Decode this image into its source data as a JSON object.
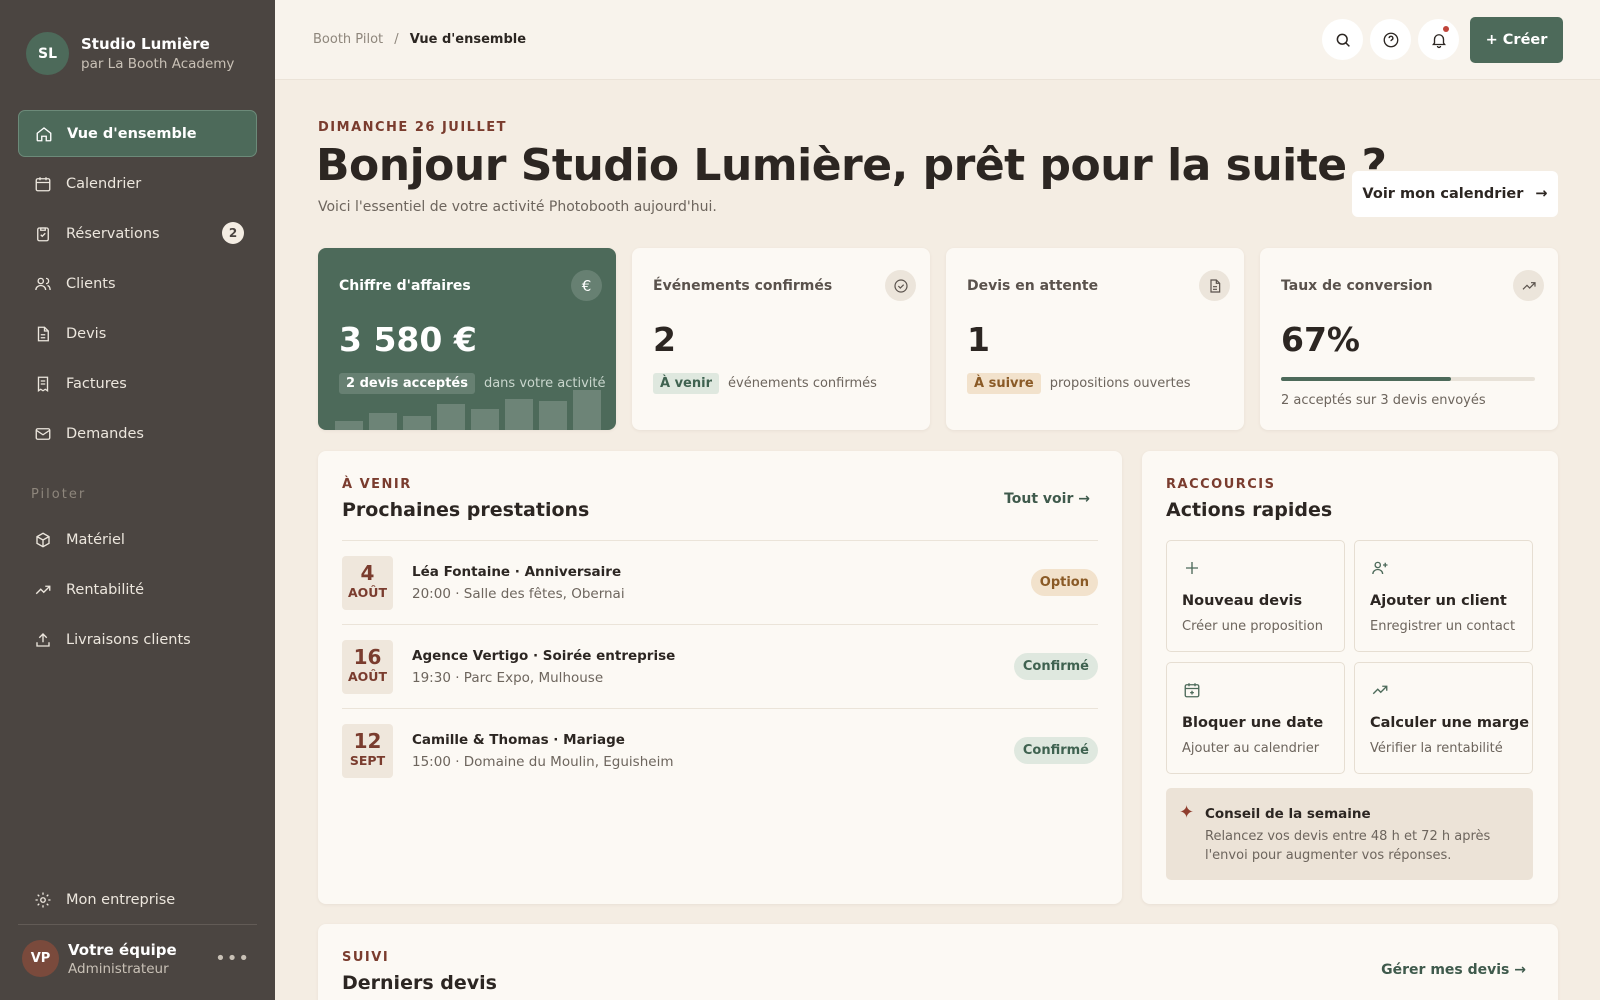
{
  "sidebar": {
    "avatar": "SL",
    "name": "Studio Lumière",
    "subtitle": "par La Booth Academy",
    "nav": [
      {
        "label": "Vue d'ensemble",
        "icon": "home-icon",
        "active": true
      },
      {
        "label": "Calendrier",
        "icon": "calendar-icon"
      },
      {
        "label": "Réservations",
        "icon": "clipboard-icon",
        "badge": "2"
      },
      {
        "label": "Clients",
        "icon": "users-icon"
      },
      {
        "label": "Devis",
        "icon": "document-icon"
      },
      {
        "label": "Factures",
        "icon": "receipt-icon"
      },
      {
        "label": "Demandes",
        "icon": "mail-icon"
      }
    ],
    "section_label": "Piloter",
    "nav2": [
      {
        "label": "Matériel",
        "icon": "box-icon"
      },
      {
        "label": "Rentabilité",
        "icon": "trending-up-icon"
      },
      {
        "label": "Livraisons clients",
        "icon": "upload-icon"
      }
    ],
    "settings": "Mon entreprise",
    "user": {
      "avatar": "VP",
      "name": "Votre équipe",
      "role": "Administrateur",
      "menu": "•••"
    }
  },
  "topbar": {
    "breadcrumb_root": "Booth Pilot",
    "breadcrumb_sep": "/",
    "breadcrumb_current": "Vue d'ensemble",
    "create_label": "+ Créer"
  },
  "hero": {
    "date": "DIMANCHE 26 JUILLET",
    "title": "Bonjour Studio Lumière, prêt pour la suite ?",
    "subtitle": "Voici l'essentiel de votre activité Photobooth aujourd'hui.",
    "calendar_button": "Voir mon calendrier",
    "calendar_arrow": "→"
  },
  "kpis": {
    "revenue": {
      "label": "Chiffre d'affaires",
      "icon": "€",
      "value": "3 580 €",
      "tag": "2 devis acceptés",
      "note": "dans votre activité",
      "sparkline": [
        9,
        18,
        15,
        27,
        22,
        33,
        30,
        42
      ]
    },
    "events": {
      "label": "Événements confirmés",
      "value": "2",
      "tag": "À venir",
      "note": "événements confirmés"
    },
    "quotes": {
      "label": "Devis en attente",
      "value": "1",
      "tag": "À suivre",
      "note": "propositions ouvertes"
    },
    "conversion": {
      "label": "Taux de conversion",
      "value": "67%",
      "progress": 0.67,
      "note": "2 acceptés sur 3 devis envoyés"
    }
  },
  "upcoming": {
    "eyebrow": "À VENIR",
    "title": "Prochaines prestations",
    "action": "Tout voir →",
    "items": [
      {
        "day": "4",
        "month": "AOÛT",
        "title": "Léa Fontaine · Anniversaire",
        "detail": "20:00 · Salle des fêtes, Obernai",
        "status": "Option",
        "status_color": "#8a5a26",
        "status_bg": "#f2e2cc"
      },
      {
        "day": "16",
        "month": "AOÛT",
        "title": "Agence Vertigo · Soirée entreprise",
        "detail": "19:30 · Parc Expo, Mulhouse",
        "status": "Confirmé",
        "status_color": "#3f6250",
        "status_bg": "#dfe8df"
      },
      {
        "day": "12",
        "month": "SEPT",
        "title": "Camille & Thomas · Mariage",
        "detail": "15:00 · Domaine du Moulin, Eguisheim",
        "status": "Confirmé",
        "status_color": "#3f6250",
        "status_bg": "#dfe8df"
      }
    ]
  },
  "shortcuts": {
    "eyebrow": "RACCOURCIS",
    "title": "Actions rapides",
    "items": [
      {
        "title": "Nouveau devis",
        "sub": "Créer une proposition",
        "icon": "plus-icon"
      },
      {
        "title": "Ajouter un client",
        "sub": "Enregistrer un contact",
        "icon": "user-plus-icon"
      },
      {
        "title": "Bloquer une date",
        "sub": "Ajouter au calendrier",
        "icon": "calendar-plus-icon"
      },
      {
        "title": "Calculer une marge",
        "sub": "Vérifier la rentabilité",
        "icon": "trending-up-icon"
      }
    ],
    "tip": {
      "icon": "✦",
      "title": "Conseil de la semaine",
      "text": "Relancez vos devis entre 48 h et 72 h après l'envoi pour augmenter vos réponses."
    }
  },
  "quotes_section": {
    "eyebrow": "SUIVI",
    "title": "Derniers devis",
    "action": "Gérer mes devis →"
  },
  "colors": {
    "accent": "#4d6a5a",
    "sidebar": "#4b4541",
    "heading_accent": "#7a3c2e",
    "background": "#f4ede3"
  }
}
